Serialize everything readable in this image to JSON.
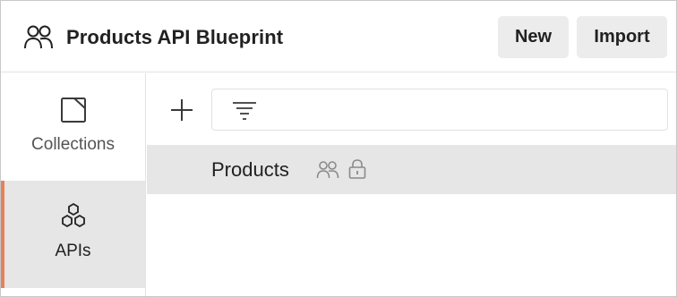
{
  "header": {
    "workspace_icon": "team-icon",
    "title": "Products API Blueprint",
    "new_label": "New",
    "import_label": "Import"
  },
  "sidebar": {
    "items": [
      {
        "label": "Collections",
        "icon": "collection-icon",
        "selected": false
      },
      {
        "label": "APIs",
        "icon": "apis-icon",
        "selected": true
      }
    ],
    "accent_color": "#e8805a"
  },
  "toolbar": {
    "add_icon": "plus-icon",
    "filter_icon": "filter-icon",
    "filter_value": "",
    "filter_placeholder": ""
  },
  "list": {
    "items": [
      {
        "label": "Products",
        "icons": [
          "team-icon",
          "lock-icon"
        ]
      }
    ]
  }
}
